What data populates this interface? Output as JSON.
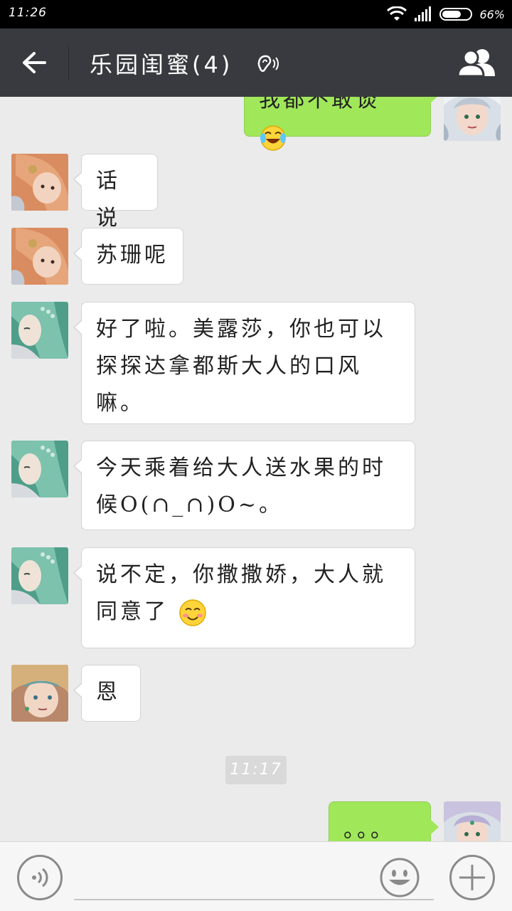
{
  "status_bar": {
    "time": "11:26",
    "battery_percent_label": "66%",
    "battery_level": 0.66
  },
  "header": {
    "title": "乐园闺蜜(4)",
    "back_icon": "arrow-left-icon",
    "earpiece_icon": "ear-icon",
    "members_icon": "group-members-icon",
    "background_color": "#393a3f"
  },
  "messages": [
    {
      "side": "right",
      "text": "我都不敢谈",
      "emoji": "tears-of-joy-emoji"
    },
    {
      "side": "left",
      "text": "话说"
    },
    {
      "side": "left",
      "text": "苏珊呢"
    },
    {
      "side": "left",
      "text": "好了啦。美露莎，你也可以探探达拿都斯大人的口风嘛。"
    },
    {
      "side": "left",
      "text": "今天乘着给大人送水果的时候O(∩_∩)O~。"
    },
    {
      "side": "left",
      "text": "说不定，你撒撒娇，大人就同意了",
      "emoji": "smile-blush-emoji"
    },
    {
      "side": "left",
      "text": "恩"
    },
    {
      "side": "right",
      "text": "。。。"
    }
  ],
  "timestamp": "11:17",
  "input_bar": {
    "voice_icon": "voice-input-icon",
    "emoji_icon": "emoji-face-icon",
    "plus_icon": "plus-icon",
    "placeholder": ""
  },
  "colors": {
    "chat_bg": "#ebebeb",
    "sent_bubble": "#a0e75a",
    "received_bubble": "#ffffff"
  }
}
